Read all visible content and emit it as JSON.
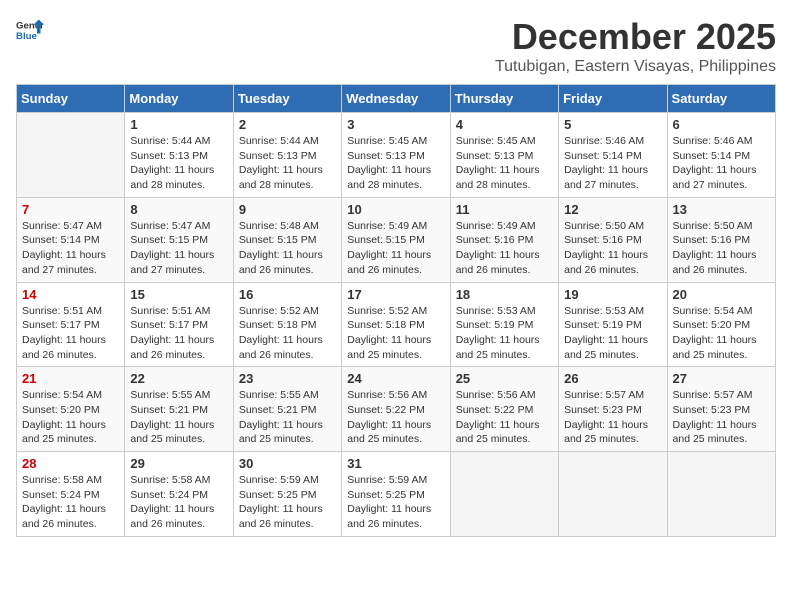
{
  "header": {
    "logo_general": "General",
    "logo_blue": "Blue",
    "month_title": "December 2025",
    "location": "Tutubigan, Eastern Visayas, Philippines"
  },
  "calendar": {
    "days_of_week": [
      "Sunday",
      "Monday",
      "Tuesday",
      "Wednesday",
      "Thursday",
      "Friday",
      "Saturday"
    ],
    "weeks": [
      [
        {
          "day": "",
          "info": ""
        },
        {
          "day": "1",
          "info": "Sunrise: 5:44 AM\nSunset: 5:13 PM\nDaylight: 11 hours\nand 28 minutes."
        },
        {
          "day": "2",
          "info": "Sunrise: 5:44 AM\nSunset: 5:13 PM\nDaylight: 11 hours\nand 28 minutes."
        },
        {
          "day": "3",
          "info": "Sunrise: 5:45 AM\nSunset: 5:13 PM\nDaylight: 11 hours\nand 28 minutes."
        },
        {
          "day": "4",
          "info": "Sunrise: 5:45 AM\nSunset: 5:13 PM\nDaylight: 11 hours\nand 28 minutes."
        },
        {
          "day": "5",
          "info": "Sunrise: 5:46 AM\nSunset: 5:14 PM\nDaylight: 11 hours\nand 27 minutes."
        },
        {
          "day": "6",
          "info": "Sunrise: 5:46 AM\nSunset: 5:14 PM\nDaylight: 11 hours\nand 27 minutes."
        }
      ],
      [
        {
          "day": "7",
          "info": "Sunrise: 5:47 AM\nSunset: 5:14 PM\nDaylight: 11 hours\nand 27 minutes."
        },
        {
          "day": "8",
          "info": "Sunrise: 5:47 AM\nSunset: 5:15 PM\nDaylight: 11 hours\nand 27 minutes."
        },
        {
          "day": "9",
          "info": "Sunrise: 5:48 AM\nSunset: 5:15 PM\nDaylight: 11 hours\nand 26 minutes."
        },
        {
          "day": "10",
          "info": "Sunrise: 5:49 AM\nSunset: 5:15 PM\nDaylight: 11 hours\nand 26 minutes."
        },
        {
          "day": "11",
          "info": "Sunrise: 5:49 AM\nSunset: 5:16 PM\nDaylight: 11 hours\nand 26 minutes."
        },
        {
          "day": "12",
          "info": "Sunrise: 5:50 AM\nSunset: 5:16 PM\nDaylight: 11 hours\nand 26 minutes."
        },
        {
          "day": "13",
          "info": "Sunrise: 5:50 AM\nSunset: 5:16 PM\nDaylight: 11 hours\nand 26 minutes."
        }
      ],
      [
        {
          "day": "14",
          "info": "Sunrise: 5:51 AM\nSunset: 5:17 PM\nDaylight: 11 hours\nand 26 minutes."
        },
        {
          "day": "15",
          "info": "Sunrise: 5:51 AM\nSunset: 5:17 PM\nDaylight: 11 hours\nand 26 minutes."
        },
        {
          "day": "16",
          "info": "Sunrise: 5:52 AM\nSunset: 5:18 PM\nDaylight: 11 hours\nand 26 minutes."
        },
        {
          "day": "17",
          "info": "Sunrise: 5:52 AM\nSunset: 5:18 PM\nDaylight: 11 hours\nand 25 minutes."
        },
        {
          "day": "18",
          "info": "Sunrise: 5:53 AM\nSunset: 5:19 PM\nDaylight: 11 hours\nand 25 minutes."
        },
        {
          "day": "19",
          "info": "Sunrise: 5:53 AM\nSunset: 5:19 PM\nDaylight: 11 hours\nand 25 minutes."
        },
        {
          "day": "20",
          "info": "Sunrise: 5:54 AM\nSunset: 5:20 PM\nDaylight: 11 hours\nand 25 minutes."
        }
      ],
      [
        {
          "day": "21",
          "info": "Sunrise: 5:54 AM\nSunset: 5:20 PM\nDaylight: 11 hours\nand 25 minutes."
        },
        {
          "day": "22",
          "info": "Sunrise: 5:55 AM\nSunset: 5:21 PM\nDaylight: 11 hours\nand 25 minutes."
        },
        {
          "day": "23",
          "info": "Sunrise: 5:55 AM\nSunset: 5:21 PM\nDaylight: 11 hours\nand 25 minutes."
        },
        {
          "day": "24",
          "info": "Sunrise: 5:56 AM\nSunset: 5:22 PM\nDaylight: 11 hours\nand 25 minutes."
        },
        {
          "day": "25",
          "info": "Sunrise: 5:56 AM\nSunset: 5:22 PM\nDaylight: 11 hours\nand 25 minutes."
        },
        {
          "day": "26",
          "info": "Sunrise: 5:57 AM\nSunset: 5:23 PM\nDaylight: 11 hours\nand 25 minutes."
        },
        {
          "day": "27",
          "info": "Sunrise: 5:57 AM\nSunset: 5:23 PM\nDaylight: 11 hours\nand 25 minutes."
        }
      ],
      [
        {
          "day": "28",
          "info": "Sunrise: 5:58 AM\nSunset: 5:24 PM\nDaylight: 11 hours\nand 26 minutes."
        },
        {
          "day": "29",
          "info": "Sunrise: 5:58 AM\nSunset: 5:24 PM\nDaylight: 11 hours\nand 26 minutes."
        },
        {
          "day": "30",
          "info": "Sunrise: 5:59 AM\nSunset: 5:25 PM\nDaylight: 11 hours\nand 26 minutes."
        },
        {
          "day": "31",
          "info": "Sunrise: 5:59 AM\nSunset: 5:25 PM\nDaylight: 11 hours\nand 26 minutes."
        },
        {
          "day": "",
          "info": ""
        },
        {
          "day": "",
          "info": ""
        },
        {
          "day": "",
          "info": ""
        }
      ]
    ]
  }
}
